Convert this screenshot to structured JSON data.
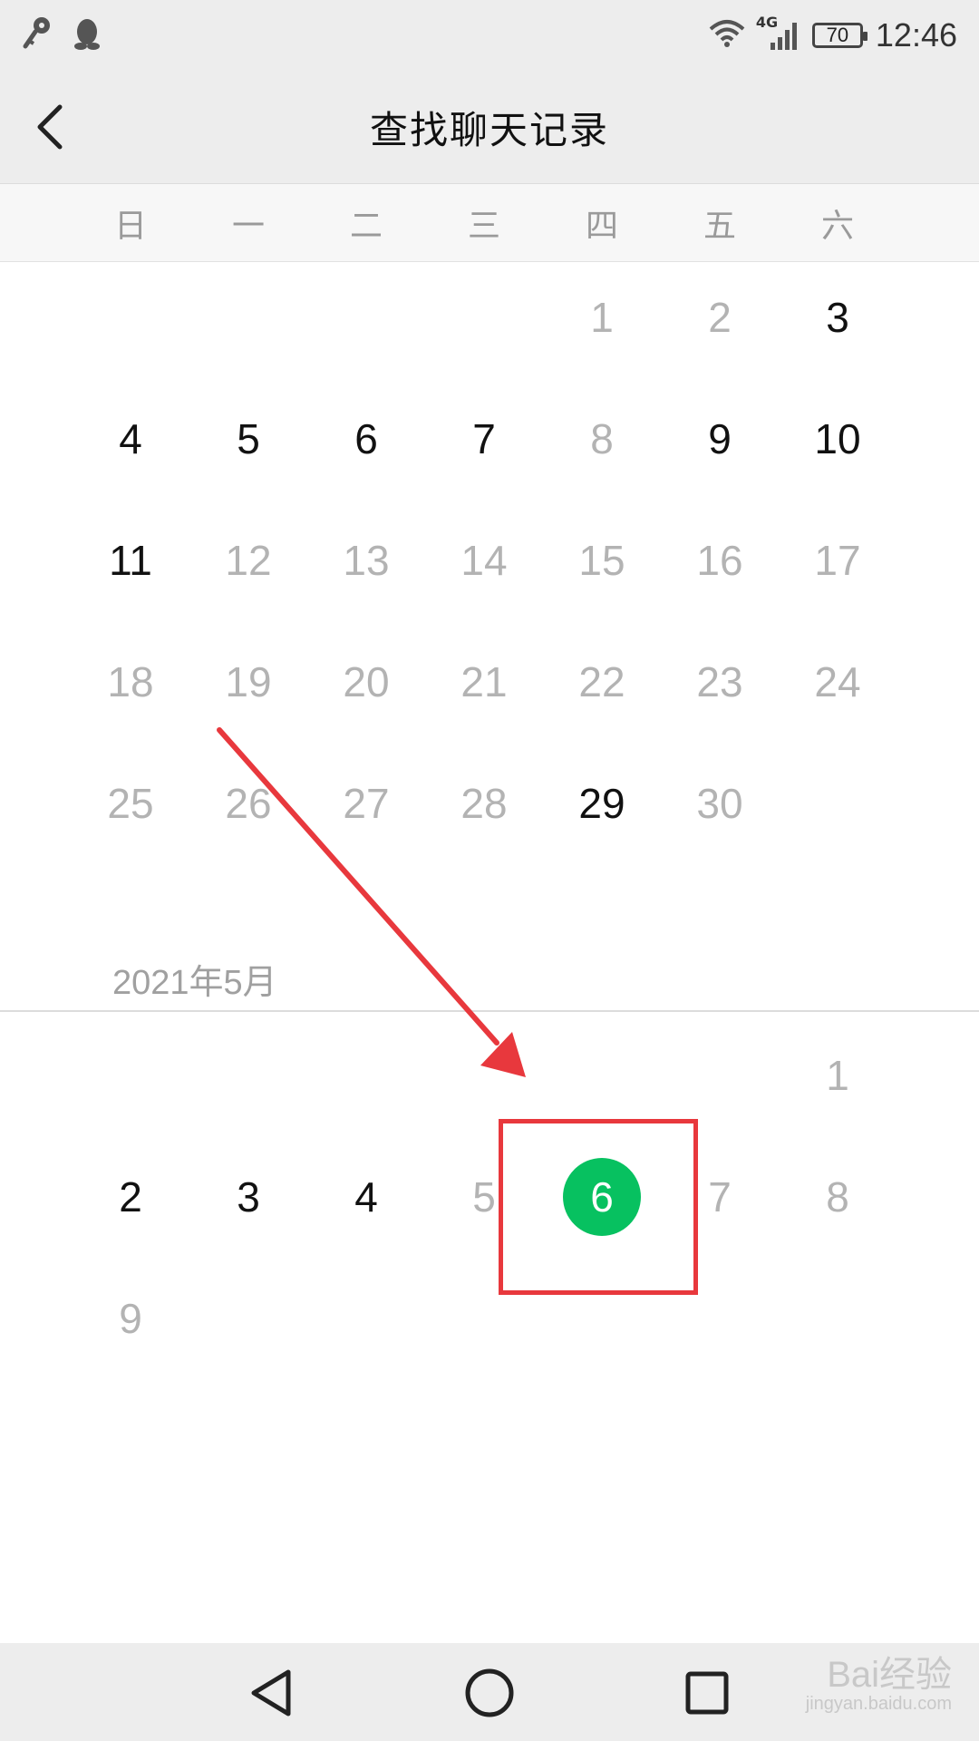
{
  "status_bar": {
    "network": "4G",
    "battery": "70",
    "time": "12:46"
  },
  "header": {
    "title": "查找聊天记录"
  },
  "weekdays": [
    "日",
    "一",
    "二",
    "三",
    "四",
    "五",
    "六"
  ],
  "april": {
    "days": [
      {
        "d": "1",
        "active": false
      },
      {
        "d": "2",
        "active": false
      },
      {
        "d": "3",
        "active": true
      },
      {
        "d": "4",
        "active": true
      },
      {
        "d": "5",
        "active": true
      },
      {
        "d": "6",
        "active": true
      },
      {
        "d": "7",
        "active": true
      },
      {
        "d": "8",
        "active": false
      },
      {
        "d": "9",
        "active": true
      },
      {
        "d": "10",
        "active": true
      },
      {
        "d": "11",
        "active": true
      },
      {
        "d": "12",
        "active": false
      },
      {
        "d": "13",
        "active": false
      },
      {
        "d": "14",
        "active": false
      },
      {
        "d": "15",
        "active": false
      },
      {
        "d": "16",
        "active": false
      },
      {
        "d": "17",
        "active": false
      },
      {
        "d": "18",
        "active": false
      },
      {
        "d": "19",
        "active": false
      },
      {
        "d": "20",
        "active": false
      },
      {
        "d": "21",
        "active": false
      },
      {
        "d": "22",
        "active": false
      },
      {
        "d": "23",
        "active": false
      },
      {
        "d": "24",
        "active": false
      },
      {
        "d": "25",
        "active": false
      },
      {
        "d": "26",
        "active": false
      },
      {
        "d": "27",
        "active": false
      },
      {
        "d": "28",
        "active": false
      },
      {
        "d": "29",
        "active": true
      },
      {
        "d": "30",
        "active": false
      }
    ]
  },
  "may": {
    "label": "2021年5月",
    "days": [
      {
        "d": "1",
        "active": false
      },
      {
        "d": "2",
        "active": true
      },
      {
        "d": "3",
        "active": true
      },
      {
        "d": "4",
        "active": true
      },
      {
        "d": "5",
        "active": false
      },
      {
        "d": "6",
        "active": true,
        "selected": true
      },
      {
        "d": "7",
        "active": false
      },
      {
        "d": "8",
        "active": false
      },
      {
        "d": "9",
        "active": false
      }
    ]
  },
  "colors": {
    "selected": "#07c160",
    "annotation": "#e8383d"
  },
  "icons": {
    "back": "chevron-left-icon",
    "nav_back": "triangle-back-icon",
    "nav_home": "circle-home-icon",
    "nav_recent": "square-recent-icon"
  },
  "watermark": {
    "brand": "Bai经验",
    "url": "jingyan.baidu.com"
  }
}
